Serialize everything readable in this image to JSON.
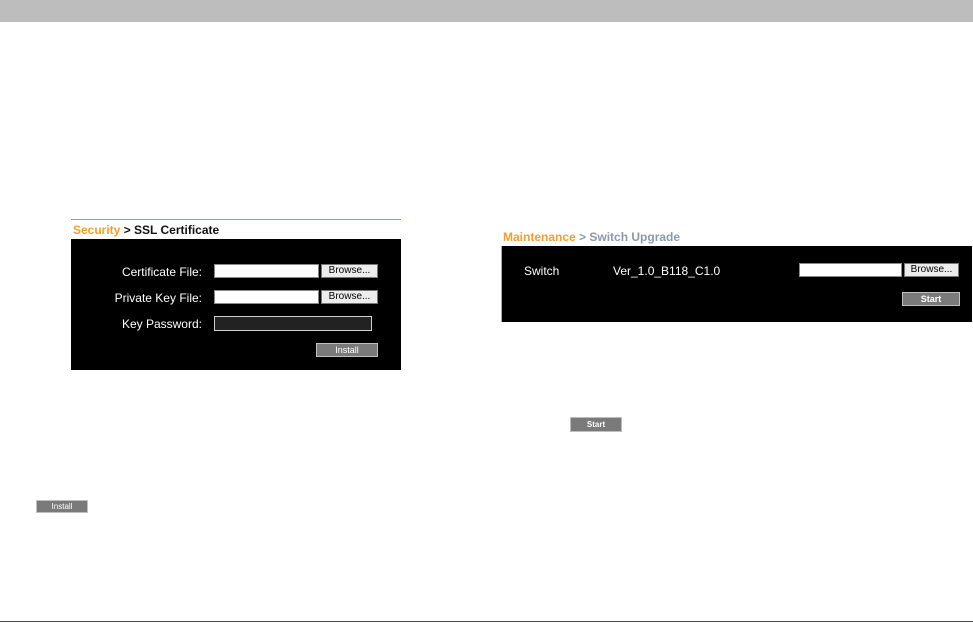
{
  "ssl": {
    "breadcrumb_section": "Security",
    "breadcrumb_sep": " > ",
    "breadcrumb_page": "SSL Certificate",
    "certificate_label": "Certificate File:",
    "certificate_value": "",
    "private_key_label": "Private Key File:",
    "private_key_value": "",
    "key_password_label": "Key Password:",
    "key_password_value": "",
    "browse_label": "Browse...",
    "install_label": "Install"
  },
  "upgrade": {
    "breadcrumb_section": "Maintenance",
    "breadcrumb_sep": " > ",
    "breadcrumb_page": "Switch Upgrade",
    "device_label": "Switch",
    "version": "Ver_1.0_B118_C1.0",
    "file_value": "",
    "browse_label": "Browse...",
    "start_label": "Start"
  },
  "standalone": {
    "install_label": "Install",
    "start_label": "Start"
  }
}
